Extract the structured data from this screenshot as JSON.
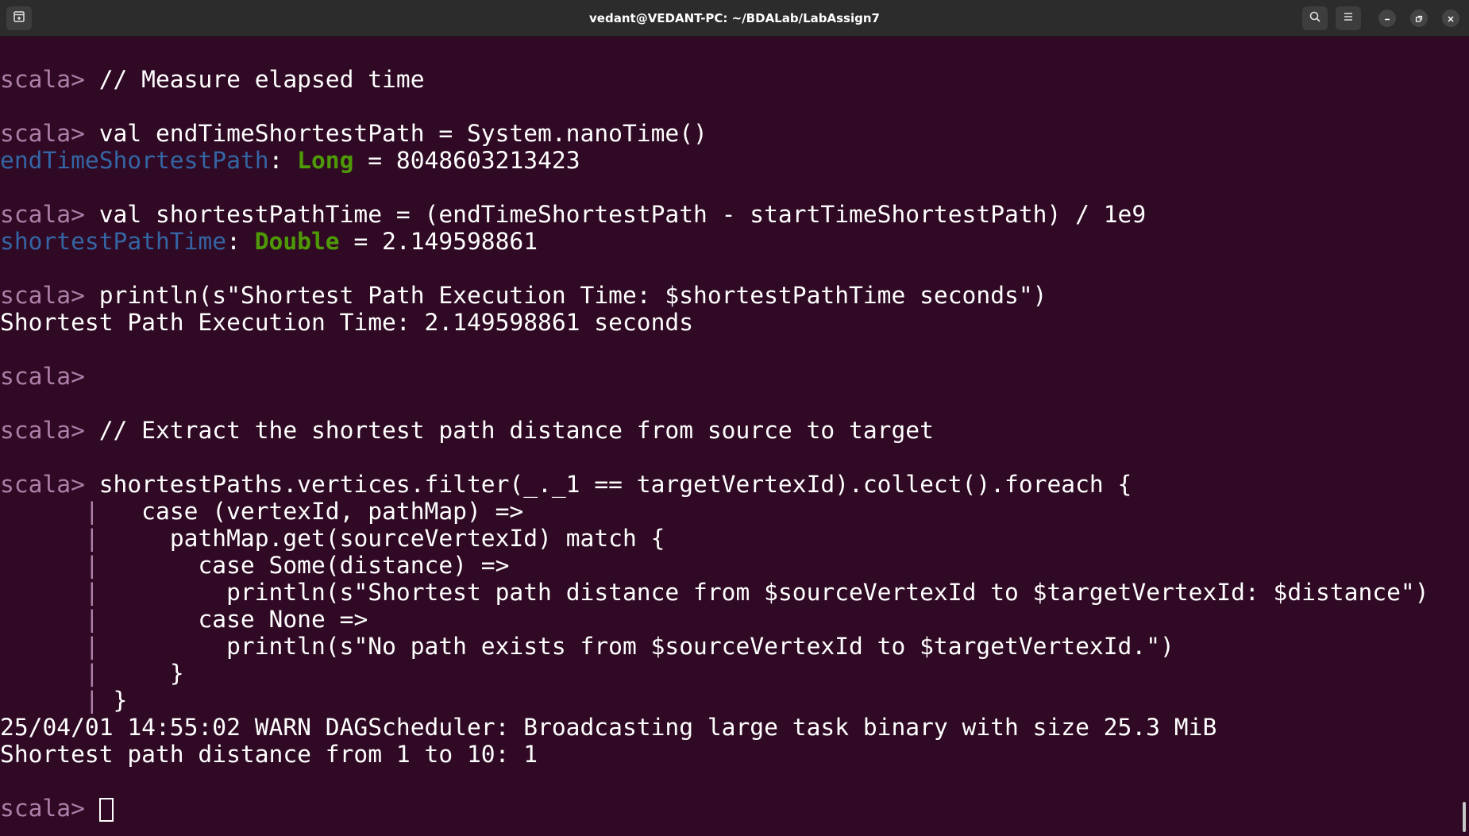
{
  "window": {
    "title": "vedant@VEDANT-PC: ~/BDALab/LabAssign7"
  },
  "icons": {
    "new_tab": "new-tab-icon",
    "search": "search-icon",
    "menu": "hamburger-menu-icon",
    "minimize": "minimize-icon",
    "maximize": "maximize-icon",
    "close": "close-icon"
  },
  "colors": {
    "background": "#300a24",
    "prompt": "#ad7fa8",
    "value_name": "#3465a4",
    "type_name": "#4e9a06",
    "text": "#ffffff"
  },
  "terminal": {
    "prompt": "scala>",
    "continuation": "|",
    "l1_cmd": " // Measure elapsed time",
    "l2_cmd": " val endTimeShortestPath = System.nanoTime()",
    "l3_name": "endTimeShortestPath",
    "l3_sep": ": ",
    "l3_type": "Long",
    "l3_value": " = 8048603213423",
    "l4_cmd": " val shortestPathTime = (endTimeShortestPath - startTimeShortestPath) / 1e9",
    "l5_name": "shortestPathTime",
    "l5_sep": ": ",
    "l5_type": "Double",
    "l5_value": " = 2.149598861",
    "l6_cmd": " println(s\"Shortest Path Execution Time: $shortestPathTime seconds\")",
    "l7_out": "Shortest Path Execution Time: 2.149598861 seconds",
    "l9_cmd": " // Extract the shortest path distance from source to target",
    "l10_cmd": " shortestPaths.vertices.filter(_._1 == targetVertexId).collect().foreach {",
    "c1": "   case (vertexId, pathMap) =>",
    "c2": "     pathMap.get(sourceVertexId) match {",
    "c3": "       case Some(distance) =>",
    "c4": "         println(s\"Shortest path distance from $sourceVertexId to $targetVertexId: $distance\")",
    "c5": "       case None =>",
    "c6": "         println(s\"No path exists from $sourceVertexId to $targetVertexId.\")",
    "c7": "     }",
    "c8": " }",
    "warn": "25/04/01 14:55:02 WARN DAGScheduler: Broadcasting large task binary with size 25.3 MiB",
    "result": "Shortest path distance from 1 to 10: 1"
  }
}
